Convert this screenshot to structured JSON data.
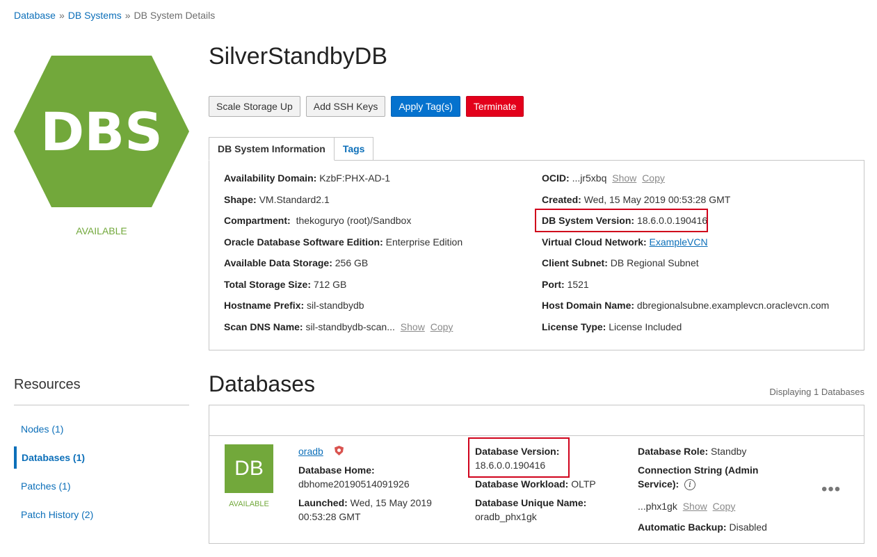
{
  "breadcrumb": {
    "items": [
      "Database",
      "DB Systems"
    ],
    "current": "DB System Details",
    "separator": "»"
  },
  "logo": {
    "text": "DBS",
    "color": "#72a83b"
  },
  "status": {
    "text": "AVAILABLE",
    "color": "#72a83b"
  },
  "title": "SilverStandbyDB",
  "actions": {
    "scale_storage": "Scale Storage Up",
    "add_ssh": "Add SSH Keys",
    "apply_tags": "Apply Tag(s)",
    "terminate": "Terminate"
  },
  "tabs": {
    "info": "DB System Information",
    "tags": "Tags"
  },
  "info": {
    "availability_domain": {
      "label": "Availability Domain:",
      "value": "KzbF:PHX-AD-1"
    },
    "shape": {
      "label": "Shape:",
      "value": "VM.Standard2.1"
    },
    "compartment": {
      "label": "Compartment:",
      "value": "thekoguryo (root)/Sandbox"
    },
    "edition": {
      "label": "Oracle Database Software Edition:",
      "value": "Enterprise Edition"
    },
    "available_storage": {
      "label": "Available Data Storage:",
      "value": "256 GB"
    },
    "total_storage": {
      "label": "Total Storage Size:",
      "value": "712 GB"
    },
    "hostname_prefix": {
      "label": "Hostname Prefix:",
      "value": "sil-standbydb"
    },
    "scan_dns": {
      "label": "Scan DNS Name:",
      "value": "sil-standbydb-scan...",
      "show": "Show",
      "copy": "Copy"
    },
    "ocid": {
      "label": "OCID:",
      "value": "...jr5xbq",
      "show": "Show",
      "copy": "Copy"
    },
    "created": {
      "label": "Created:",
      "value": "Wed, 15 May 2019 00:53:28 GMT"
    },
    "db_system_version": {
      "label": "DB System Version:",
      "value": "18.6.0.0.190416"
    },
    "vcn": {
      "label": "Virtual Cloud Network:",
      "value": "ExampleVCN"
    },
    "client_subnet": {
      "label": "Client Subnet:",
      "value": "DB Regional Subnet"
    },
    "port": {
      "label": "Port:",
      "value": "1521"
    },
    "host_domain": {
      "label": "Host Domain Name:",
      "value": "dbregionalsubne.examplevcn.oraclevcn.com"
    },
    "license_type": {
      "label": "License Type:",
      "value": "License Included"
    }
  },
  "resources": {
    "title": "Resources",
    "items": [
      {
        "label": "Nodes (1)",
        "active": false
      },
      {
        "label": "Databases (1)",
        "active": true
      },
      {
        "label": "Patches (1)",
        "active": false
      },
      {
        "label": "Patch History (2)",
        "active": false
      }
    ]
  },
  "databases": {
    "title": "Databases",
    "count_text": "Displaying 1 Databases",
    "item": {
      "tile_text": "DB",
      "status": "AVAILABLE",
      "name": "oradb",
      "home_label": "Database Home:",
      "home_value": "dbhome20190514091926",
      "launched_label": "Launched:",
      "launched_value_1": "Wed, 15 May 2019",
      "launched_value_2": "00:53:28 GMT",
      "version_label": "Database Version:",
      "version_value": "18.6.0.0.190416",
      "workload_label": "Database Workload:",
      "workload_value": "OLTP",
      "unique_name_label": "Database Unique Name:",
      "unique_name_value": "oradb_phx1gk",
      "role_label": "Database Role:",
      "role_value": "Standby",
      "conn_label_1": "Connection String (Admin",
      "conn_label_2": "Service):",
      "conn_value": "...phx1gk",
      "conn_show": "Show",
      "conn_copy": "Copy",
      "backup_label": "Automatic Backup:",
      "backup_value": "Disabled",
      "menu": "•••"
    }
  }
}
